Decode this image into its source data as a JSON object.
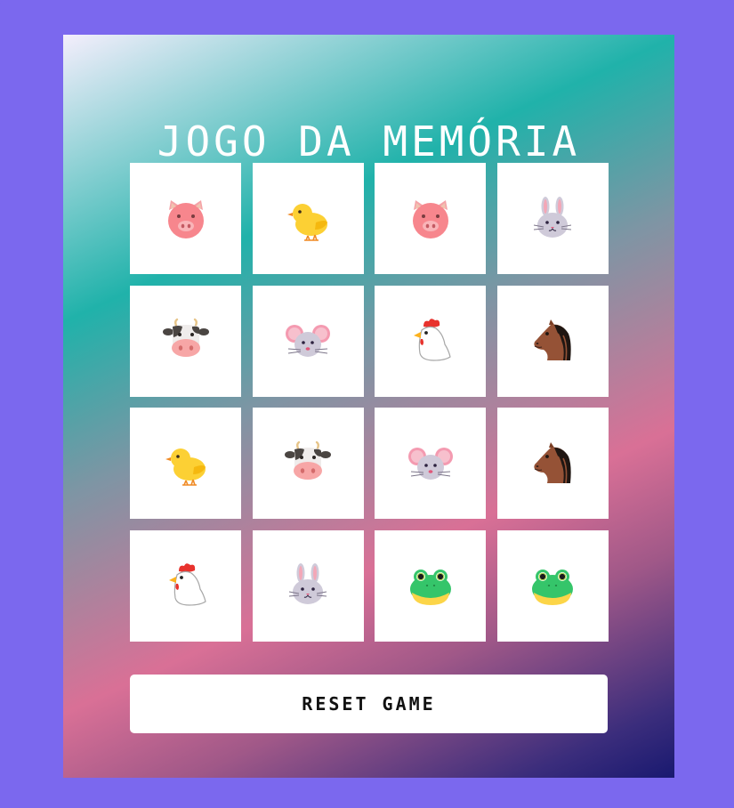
{
  "game": {
    "title": "JOGO DA MEMÓRIA",
    "reset_label": "RESET GAME"
  },
  "cards": [
    {
      "animal": "pig",
      "icon": "pig-face-icon"
    },
    {
      "animal": "chick",
      "icon": "baby-chick-icon"
    },
    {
      "animal": "pig",
      "icon": "pig-face-icon"
    },
    {
      "animal": "rabbit",
      "icon": "rabbit-face-icon"
    },
    {
      "animal": "cow",
      "icon": "cow-face-icon"
    },
    {
      "animal": "mouse",
      "icon": "mouse-face-icon"
    },
    {
      "animal": "rooster",
      "icon": "rooster-icon"
    },
    {
      "animal": "horse",
      "icon": "horse-face-icon"
    },
    {
      "animal": "chick",
      "icon": "baby-chick-icon"
    },
    {
      "animal": "cow",
      "icon": "cow-face-icon"
    },
    {
      "animal": "mouse",
      "icon": "mouse-face-icon"
    },
    {
      "animal": "horse",
      "icon": "horse-face-icon"
    },
    {
      "animal": "rooster",
      "icon": "rooster-icon"
    },
    {
      "animal": "rabbit",
      "icon": "rabbit-face-icon"
    },
    {
      "animal": "frog",
      "icon": "frog-face-icon"
    },
    {
      "animal": "frog",
      "icon": "frog-face-icon"
    }
  ],
  "colors": {
    "page_background": "#7b68ee",
    "card_background": "#ffffff",
    "title_text": "#ffffff",
    "gradient": [
      "#f4eefc",
      "#20b2aa",
      "#d97096",
      "#191970"
    ]
  }
}
